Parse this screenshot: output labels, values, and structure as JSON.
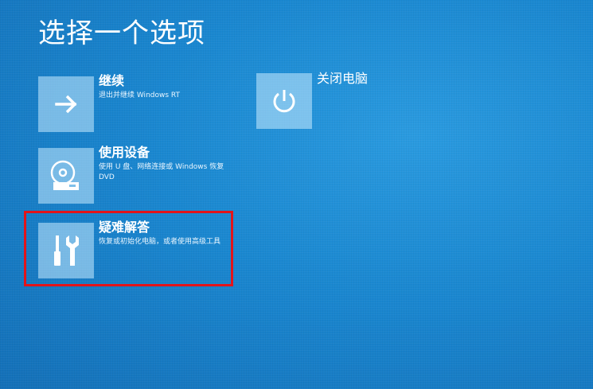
{
  "screen": {
    "title": "选择一个选项"
  },
  "options": [
    {
      "id": "continue",
      "title": "继续",
      "description": "退出并继续 Windows RT",
      "icon": "arrow-right-icon"
    },
    {
      "id": "use-device",
      "title": "使用设备",
      "description": "使用 U 盘、网络连接或 Windows 恢复 DVD",
      "icon": "disc-drive-icon"
    },
    {
      "id": "troubleshoot",
      "title": "疑难解答",
      "description": "恢复或初始化电脑，或者使用高级工具",
      "icon": "tools-icon"
    },
    {
      "id": "shutdown",
      "title": "关闭电脑",
      "description": "",
      "icon": "power-icon"
    }
  ],
  "colors": {
    "background": "#1a87d0",
    "tile": "#a8d8f2",
    "highlight": "#e2141a"
  }
}
